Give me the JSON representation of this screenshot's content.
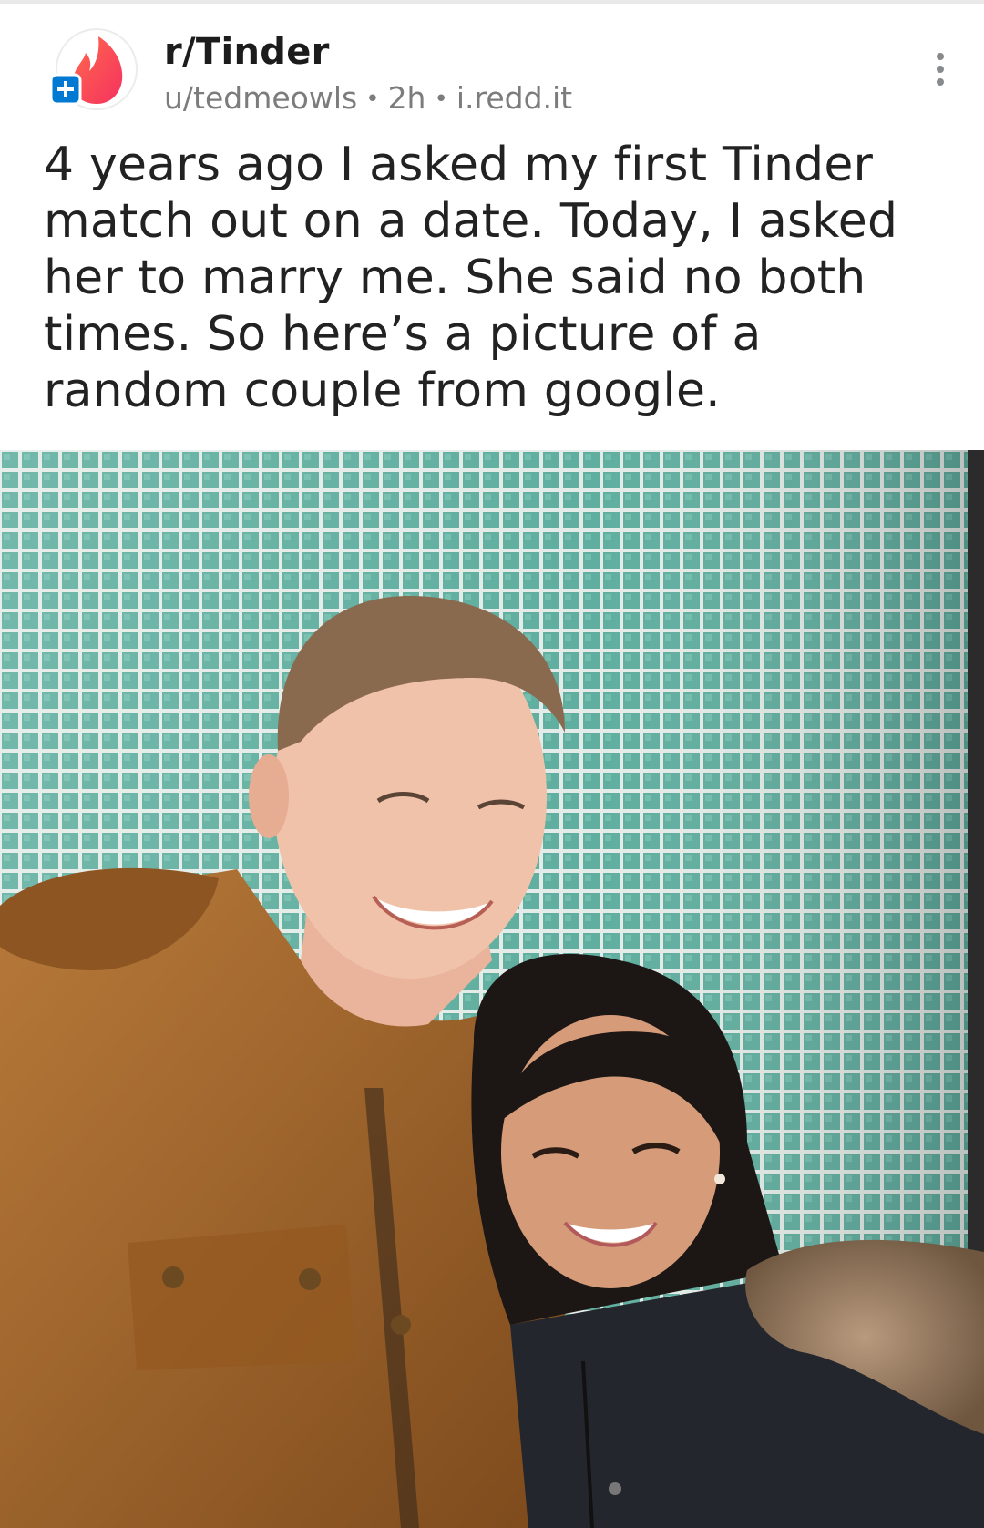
{
  "post": {
    "subreddit": "r/Tinder",
    "author": "u/tedmeowls",
    "age": "2h",
    "domain": "i.redd.it",
    "separator": "•",
    "title": "4 years ago I asked my first Tinder match out on a date. Today, I asked her to marry me. She said no both times. So here’s a picture of a random couple from google."
  },
  "icons": {
    "subreddit_avatar": "tinder-flame-icon",
    "join_badge": "plus-icon",
    "overflow_menu": "more-vertical-icon"
  },
  "colors": {
    "tinder_brand": "#fd4b5b",
    "join_badge": "#0079d3",
    "tile_wall": "#6cb3a5",
    "jacket": "#a0652b"
  }
}
